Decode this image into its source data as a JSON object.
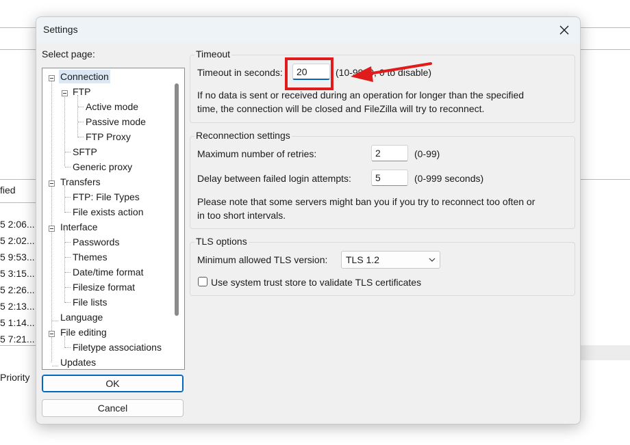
{
  "background_app": {
    "column_header": "fied",
    "times": [
      "5 2:06...",
      "5 2:02...",
      "5 9:53...",
      "5 3:15...",
      "5 2:26...",
      "5 2:13...",
      "5 1:14...",
      "5 7:21..."
    ],
    "priority_label": "Priority"
  },
  "dialog": {
    "title": "Settings",
    "select_page_label": "Select page:",
    "tree": [
      "Connection",
      "FTP",
      "Active mode",
      "Passive mode",
      "FTP Proxy",
      "SFTP",
      "Generic proxy",
      "Transfers",
      "FTP: File Types",
      "File exists action",
      "Interface",
      "Passwords",
      "Themes",
      "Date/time format",
      "Filesize format",
      "File lists",
      "Language",
      "File editing",
      "Filetype associations",
      "Updates"
    ],
    "ok_label": "OK",
    "cancel_label": "Cancel",
    "timeout": {
      "title": "Timeout",
      "label": "Timeout in seconds:",
      "value": "20",
      "hint": "(10-9999, 0 to disable)",
      "desc_line1": "If no data is sent or received during an operation for longer than the specified",
      "desc_line2": "time, the connection will be closed and FileZilla will try to reconnect."
    },
    "reconnection": {
      "title": "Reconnection settings",
      "retries_label": "Maximum number of retries:",
      "retries_value": "2",
      "retries_hint": "(0-99)",
      "delay_label": "Delay between failed login attempts:",
      "delay_value": "5",
      "delay_hint": "(0-999 seconds)",
      "note_line1": "Please note that some servers might ban you if you try to reconnect too often or",
      "note_line2": "in too short intervals."
    },
    "tls": {
      "title": "TLS options",
      "min_version_label": "Minimum allowed TLS version:",
      "min_version_value": "TLS 1.2",
      "trust_store_label": "Use system trust store to validate TLS certificates",
      "trust_store_checked": false
    }
  },
  "annotation_color": "#e01b1b",
  "accent_color": "#0067c0"
}
